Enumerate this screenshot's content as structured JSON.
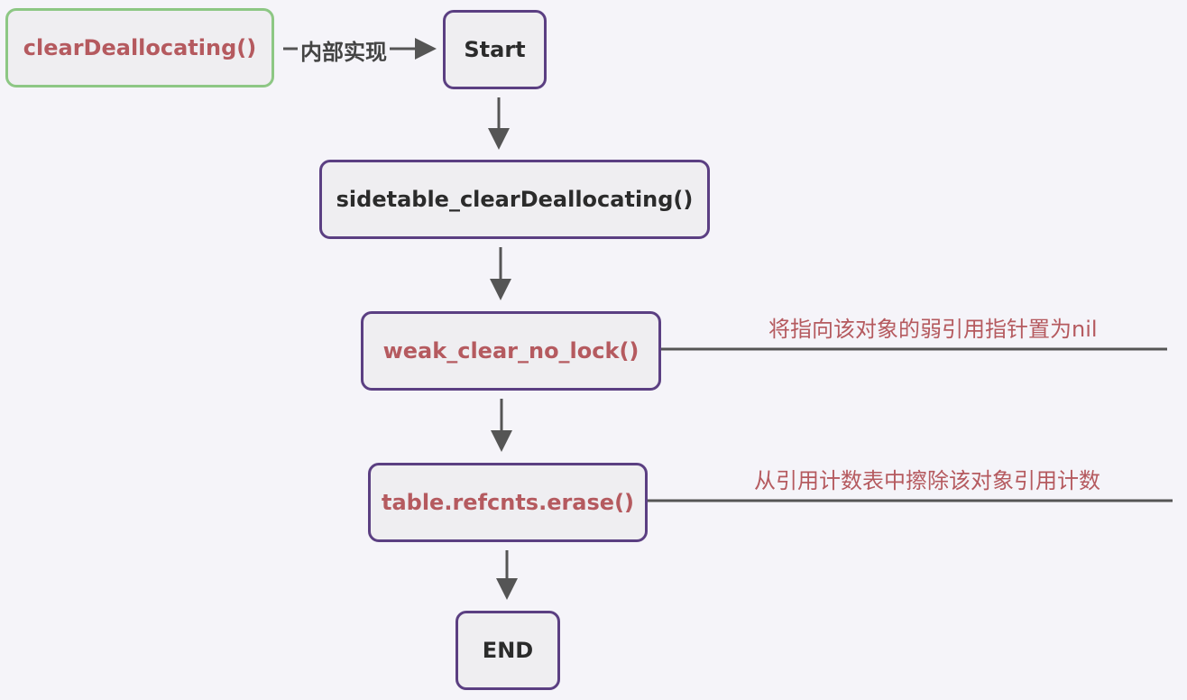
{
  "nodes": {
    "entry": "clearDeallocating()",
    "start": "Start",
    "sidetable": "sidetable_clearDeallocating()",
    "weak_clear": "weak_clear_no_lock()",
    "erase": "table.refcnts.erase()",
    "end": "END"
  },
  "edge_labels": {
    "entry_to_start": "内部实现"
  },
  "notes": {
    "weak_clear": "将指向该对象的弱引用指针置为nil",
    "erase": "从引用计数表中擦除该对象引用计数"
  },
  "colors": {
    "node_border": "#5b3f82",
    "entry_border": "#8dc784",
    "highlight_text": "#b55a5f",
    "arrow": "#555555"
  }
}
